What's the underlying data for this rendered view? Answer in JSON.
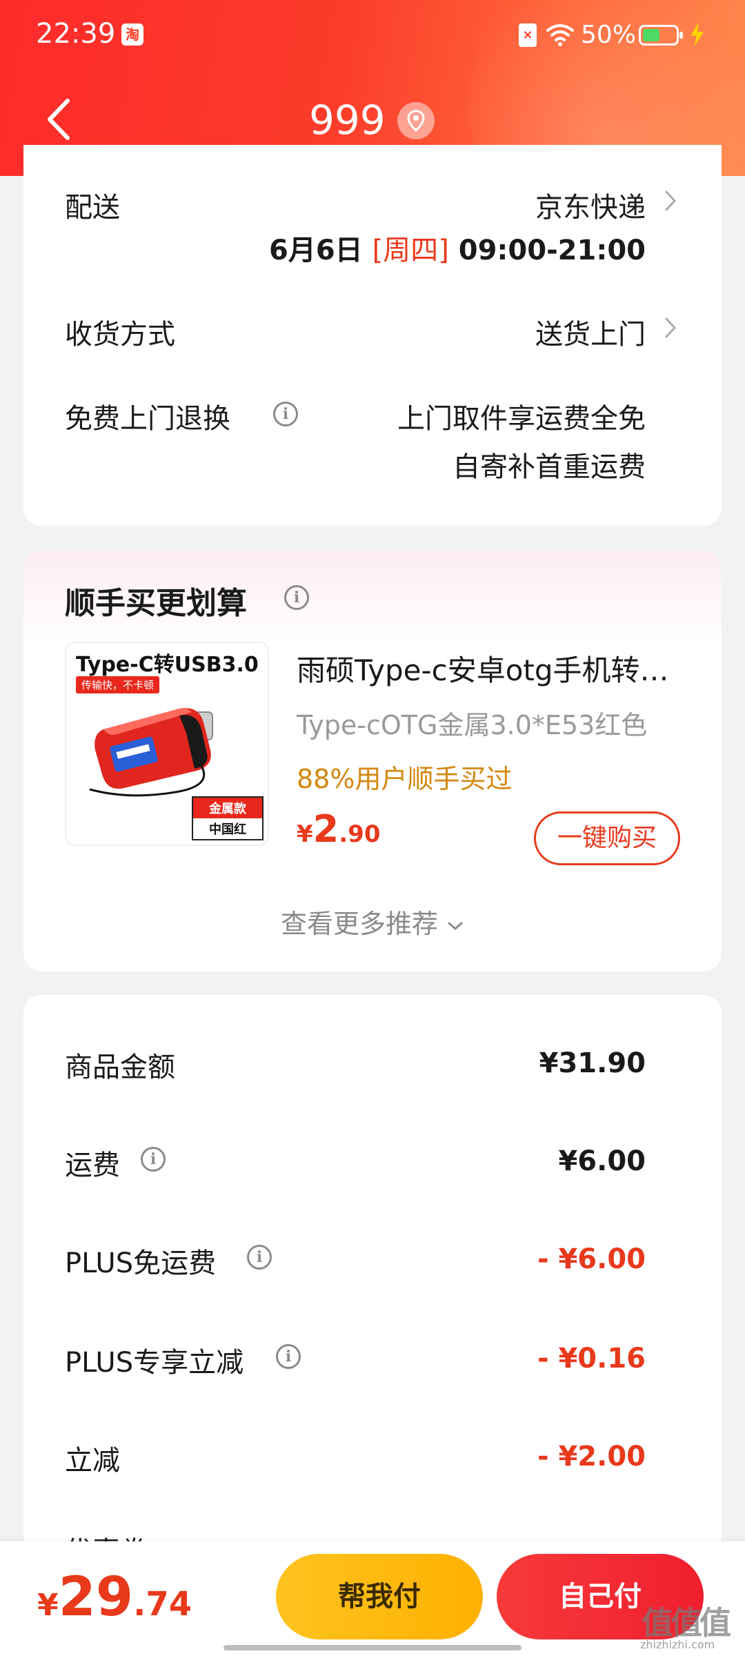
{
  "status_bar": {
    "time": "22:39",
    "app_badge": "淘",
    "battery": "50%"
  },
  "nav": {
    "title": "999"
  },
  "delivery": {
    "label": "配送",
    "carrier": "京东快递",
    "date": "6月6日",
    "weekday": "[周四]",
    "time_range": "09:00-21:00",
    "method_label": "收货方式",
    "method_value": "送货上门",
    "return_label": "免费上门退换",
    "return_line1": "上门取件享运费全免",
    "return_line2": "自寄补首重运费"
  },
  "addon": {
    "title": "顺手买更划算",
    "thumb_title": "Type-C转USB3.0",
    "thumb_tag": "传输快，不卡顿",
    "thumb_badge_top": "金属款",
    "thumb_badge_bottom": "中国红",
    "product_name": "雨硕Type-c安卓otg手机转接头",
    "product_spec": "Type-cOTG金属3.0*E53红色",
    "social_proof": "88%用户顺手买过",
    "price_currency": "¥",
    "price_int": "2",
    "price_dec": ".90",
    "buy_button": "一键购买",
    "more_link": "查看更多推荐"
  },
  "fees": {
    "goods_label": "商品金额",
    "goods_value": "¥31.90",
    "shipping_label": "运费",
    "shipping_value": "¥6.00",
    "plus_free_label": "PLUS免运费",
    "plus_free_value": "- ¥6.00",
    "plus_discount_label": "PLUS专享立减",
    "plus_discount_value": "- ¥0.16",
    "instant_label": "立减",
    "instant_value": "- ¥2.00",
    "coupon_label": "优惠券"
  },
  "bottom_bar": {
    "currency": "¥",
    "total_int": "29",
    "total_dec": ".74",
    "help_pay": "帮我付",
    "self_pay": "自己付"
  },
  "watermark": {
    "text": "值值值",
    "sub": "zhizhizhi.com"
  },
  "colors": {
    "brand_red": "#e8391b",
    "header_gradient_start": "#ff2a2a",
    "header_gradient_end": "#ff8a50",
    "social_orange": "#d4870f",
    "help_pay_yellow": "#ffc31f"
  }
}
